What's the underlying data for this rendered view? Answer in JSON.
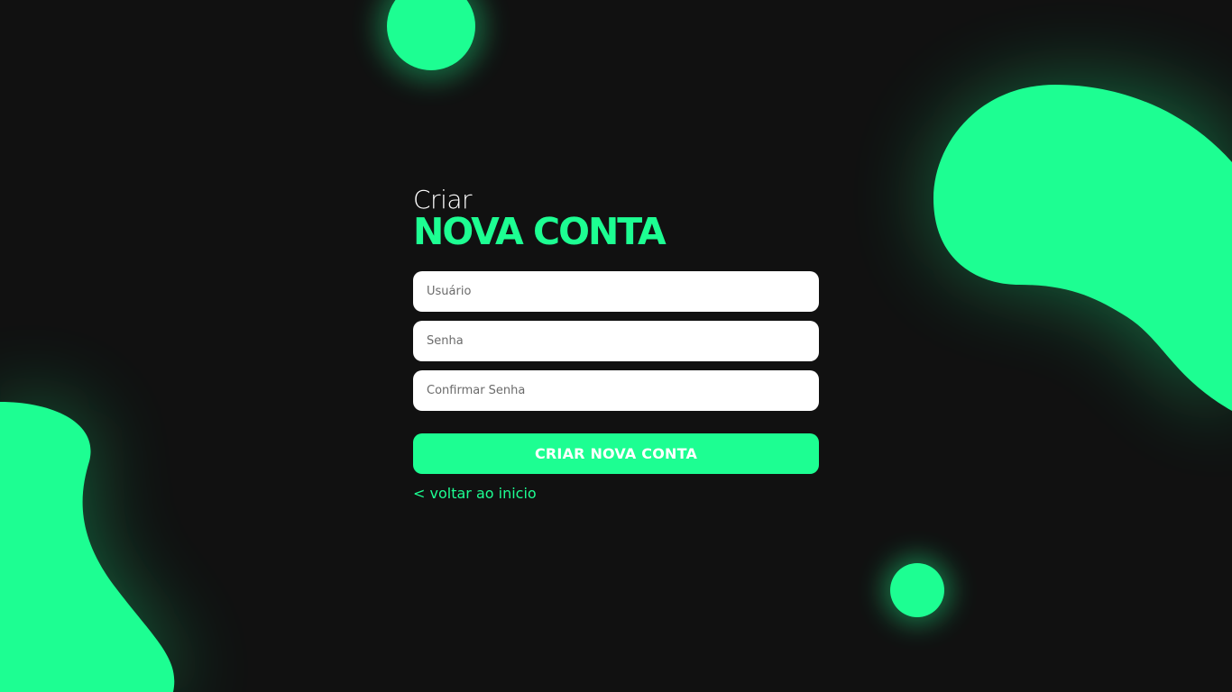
{
  "heading": {
    "small": "Criar",
    "big": "NOVA CONTA"
  },
  "form": {
    "username_placeholder": "Usuário",
    "password_placeholder": "Senha",
    "confirm_password_placeholder": "Confirmar Senha",
    "username_value": "",
    "password_value": "",
    "confirm_password_value": "",
    "submit_label": "CRIAR NOVA CONTA",
    "back_label": "< voltar ao inicio"
  },
  "colors": {
    "accent": "#1dfe92",
    "background": "#111111",
    "field_background": "#ffffff"
  }
}
